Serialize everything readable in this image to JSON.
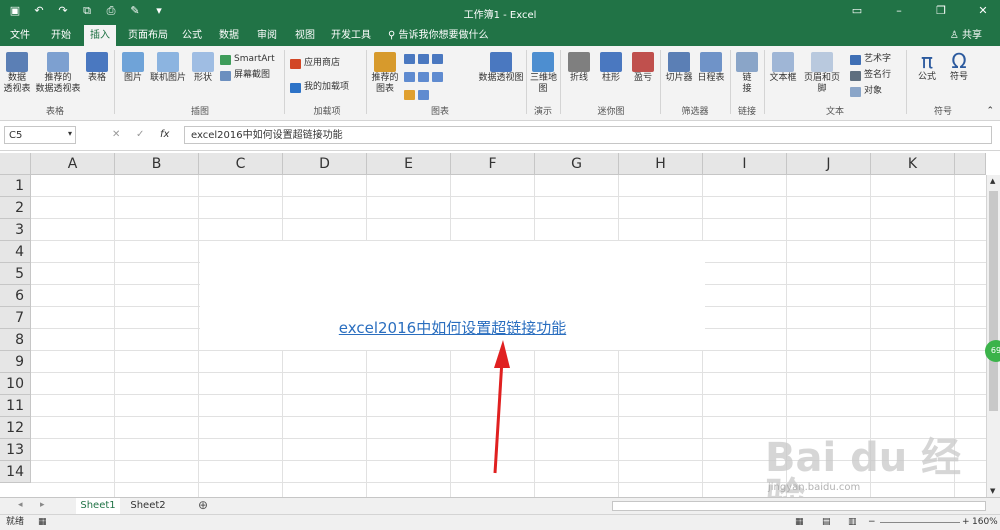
{
  "window": {
    "title": "工作簿1 - Excel",
    "share": "共享",
    "tell_me": "告诉我你想要做什么"
  },
  "tabs": [
    "文件",
    "开始",
    "插入",
    "页面布局",
    "公式",
    "数据",
    "审阅",
    "视图",
    "开发工具"
  ],
  "active_tab": "插入",
  "ribbon": {
    "pivot": "数据\n透视表",
    "rec_pivot": "推荐的\n数据透视表",
    "table": "表格",
    "tables_group": "表格",
    "picture": "图片",
    "online_picture": "联机图片",
    "shapes": "形状",
    "smartart": "SmartArt",
    "screenshot": "屏幕截图",
    "illustrations_group": "插图",
    "store": "应用商店",
    "my_addins": "我的加载项",
    "addins_group": "加载项",
    "rec_charts": "推荐的\n图表",
    "pivot_chart": "数据透视图",
    "charts_group": "图表",
    "map3d": "三维地\n图",
    "tours_group": "演示",
    "line": "折线",
    "column": "柱形",
    "winloss": "盈亏",
    "sparklines_group": "迷你图",
    "slicer": "切片器",
    "timeline": "日程表",
    "filters_group": "筛选器",
    "link": "链\n接",
    "links_group": "链接",
    "textbox": "文本框",
    "header_footer": "页眉和页脚",
    "wordart": "艺术字",
    "signature": "签名行",
    "object": "对象",
    "text_group": "文本",
    "equation": "公式",
    "symbol": "符号",
    "symbols_group": "符号"
  },
  "formula_bar": {
    "name_box": "C5",
    "fx": "fx",
    "content": "excel2016中如何设置超链接功能"
  },
  "columns": [
    "A",
    "B",
    "C",
    "D",
    "E",
    "F",
    "G",
    "H",
    "I",
    "J",
    "K"
  ],
  "rows": [
    "1",
    "2",
    "3",
    "4",
    "5",
    "6",
    "7",
    "8",
    "9",
    "10",
    "11",
    "12",
    "13",
    "14"
  ],
  "cell_link": "excel2016中如何设置超链接功能",
  "sheets": [
    "Sheet1",
    "Sheet2"
  ],
  "active_sheet": "Sheet1",
  "status": {
    "ready": "就绪",
    "zoom": "160%"
  },
  "side_badge": "69",
  "watermark": {
    "brand": "Bai du 经验",
    "url": "jingyan.baidu.com"
  },
  "colors": {
    "excel_green": "#217346",
    "link_blue": "#2a6ebf",
    "arrow_red": "#e02020"
  }
}
